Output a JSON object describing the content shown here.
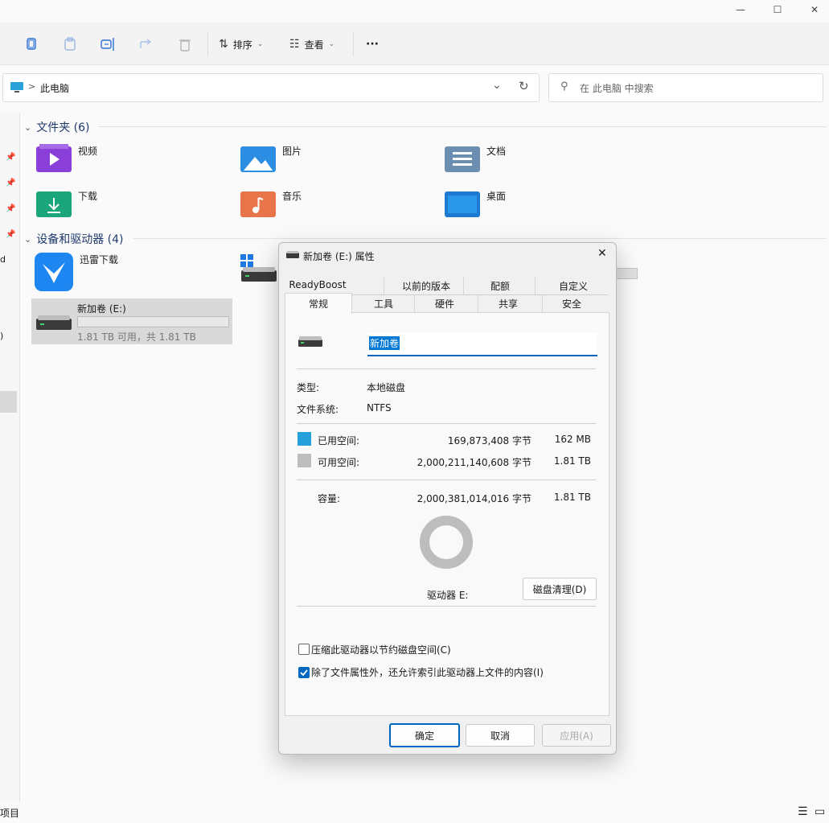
{
  "window": {
    "minimize_glyph": "—",
    "maximize_glyph": "☐",
    "close_glyph": "✕"
  },
  "toolbar": {
    "sort_label": "排序",
    "view_label": "查看",
    "more_label": "···"
  },
  "address": {
    "separator": ">",
    "path": "此电脑",
    "dropdown_glyph": "⌄",
    "refresh_glyph": "↻"
  },
  "search": {
    "placeholder": "在 此电脑 中搜索"
  },
  "sections": {
    "folders": {
      "title": "文件夹 (6)",
      "items": [
        "视频",
        "图片",
        "文档",
        "下载",
        "音乐",
        "桌面"
      ]
    },
    "drives": {
      "title": "设备和驱动器 (4)",
      "xunlei": "迅雷下载",
      "newvol_name": "新加卷 (E:)",
      "newvol_space": "1.81 TB 可用，共 1.81 TB"
    }
  },
  "left_pane": {
    "partial_d": "d",
    "partial_paren": ")"
  },
  "dialog": {
    "title": "新加卷 (E:) 属性",
    "close_glyph": "✕",
    "tabs_row1": [
      "ReadyBoost",
      "以前的版本",
      "配额",
      "自定义"
    ],
    "tabs_row2": [
      "常规",
      "工具",
      "硬件",
      "共享",
      "安全"
    ],
    "name_value": "新加卷",
    "type_label": "类型:",
    "type_value": "本地磁盘",
    "fs_label": "文件系统:",
    "fs_value": "NTFS",
    "used_label": "已用空间:",
    "used_bytes": "169,873,408 字节",
    "used_size": "162 MB",
    "free_label": "可用空间:",
    "free_bytes": "2,000,211,140,608 字节",
    "free_size": "1.81 TB",
    "cap_label": "容量:",
    "cap_bytes": "2,000,381,014,016 字节",
    "cap_size": "1.81 TB",
    "drive_label": "驱动器 E:",
    "cleanup_button": "磁盘清理(D)",
    "compress_label": "压缩此驱动器以节约磁盘空间(C)",
    "compress_checked": false,
    "index_label": "除了文件属性外，还允许索引此驱动器上文件的内容(I)",
    "index_checked": true,
    "ok_button": "确定",
    "cancel_button": "取消",
    "apply_button": "应用(A)",
    "used_color": "#26a0da",
    "free_color": "#bdbdbd",
    "used_fraction": 0.0001
  },
  "status": {
    "items_label": "项目"
  },
  "colors": {
    "accent": "#0067c0",
    "selection": "#0078d4"
  }
}
